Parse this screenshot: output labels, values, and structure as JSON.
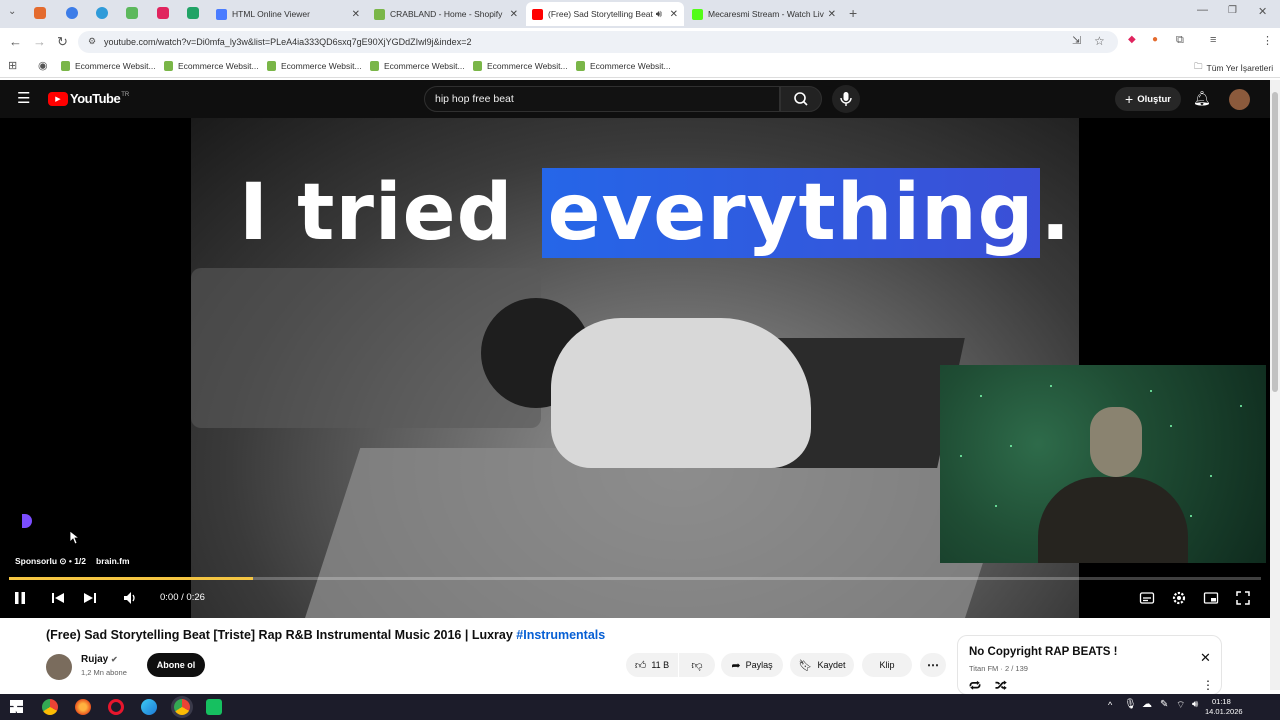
{
  "browser": {
    "tabs": [
      {
        "title": "HTML Online Viewer",
        "favicon_color": "#4a7cff"
      },
      {
        "title": "CRABLAND - Home - Shopify",
        "favicon_color": "#7ab648"
      },
      {
        "title": "(Free) Sad Storytelling Beat",
        "favicon_color": "#ff0000",
        "active": true
      },
      {
        "title": "Mecaresmi Stream - Watch Liv",
        "favicon_color": "#53fc18"
      }
    ],
    "address": "youtube.com/watch?v=Di0mfa_ly3w&list=PLeA4ia333QD6sxq7gE90XjYGDdZIwl9j&index=2",
    "bookmarks": [
      "Ecommerce Websit...",
      "Ecommerce Websit...",
      "Ecommerce Websit...",
      "Ecommerce Websit...",
      "Ecommerce Websit...",
      "Ecommerce Websit..."
    ],
    "all_bookmarks_label": "Tüm Yer İşaretleri"
  },
  "youtube": {
    "logo_text": "YouTube",
    "logo_region": "TR",
    "search_value": "hip hop free beat",
    "create_label": "Oluştur"
  },
  "player": {
    "headline_plain": "I tried ",
    "headline_highlight": "everything",
    "headline_tail": "...",
    "ad_label": "Sponsorlu ⊙ • 1/2",
    "ad_site": "brain.fm",
    "timecode": "0:00 / 0:26",
    "progress_fraction": 0.195
  },
  "video": {
    "title": "(Free) Sad Storytelling Beat [Triste] Rap R&B Instrumental Music 2016 | Luxray ",
    "hashtag": "#Instrumentals",
    "channel": "Rujay",
    "subscribers": "1,2 Mn abone",
    "subscribe_label": "Abone ol",
    "likes": "11 B",
    "share_label": "Paylaş",
    "save_label": "Kaydet",
    "clip_label": "Klip"
  },
  "playlist": {
    "title": "No Copyright RAP BEATS !",
    "subtitle": "Titan FM · 2 / 139"
  },
  "taskbar": {
    "time": "01:18",
    "date": "14.01.2026"
  }
}
